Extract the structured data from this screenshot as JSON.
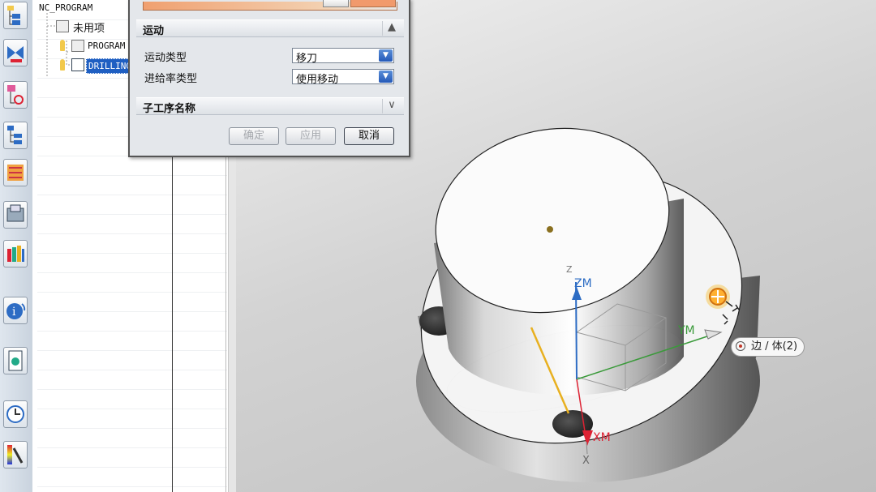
{
  "navigator": {
    "root_label": "NC_PROGRAM",
    "items": [
      {
        "label": "未用项"
      },
      {
        "label": "PROGRAM"
      },
      {
        "label": "DRILLING"
      }
    ]
  },
  "dialog": {
    "sections": {
      "motion": {
        "title": "运动"
      },
      "sub_operation": {
        "title": "子工序名称"
      }
    },
    "fields": {
      "motion_type": {
        "label": "运动类型",
        "value": "移刀"
      },
      "feed_type": {
        "label": "进给率类型",
        "value": "使用移动"
      }
    },
    "buttons": {
      "ok": "确定",
      "apply": "应用",
      "cancel": "取消"
    }
  },
  "viewport": {
    "axes": {
      "z": "Z",
      "zm": "ZM",
      "ym": "YM",
      "xm": "XM",
      "x": "X"
    },
    "selection_tooltip": "边 / 体(2)"
  },
  "colors": {
    "selected_highlight": "#1f5fc2",
    "dialog_accent": "#f19a6c",
    "tool_path": "#e8b020"
  },
  "icons": {
    "toolbar": [
      "program-order-icon",
      "machine-tool-icon",
      "geometry-view-icon",
      "method-view-icon",
      "create-operation-icon",
      "toolpath-icon",
      "verify-icon",
      "information-icon",
      "document-icon",
      "history-clock-icon",
      "post-process-icon"
    ]
  }
}
